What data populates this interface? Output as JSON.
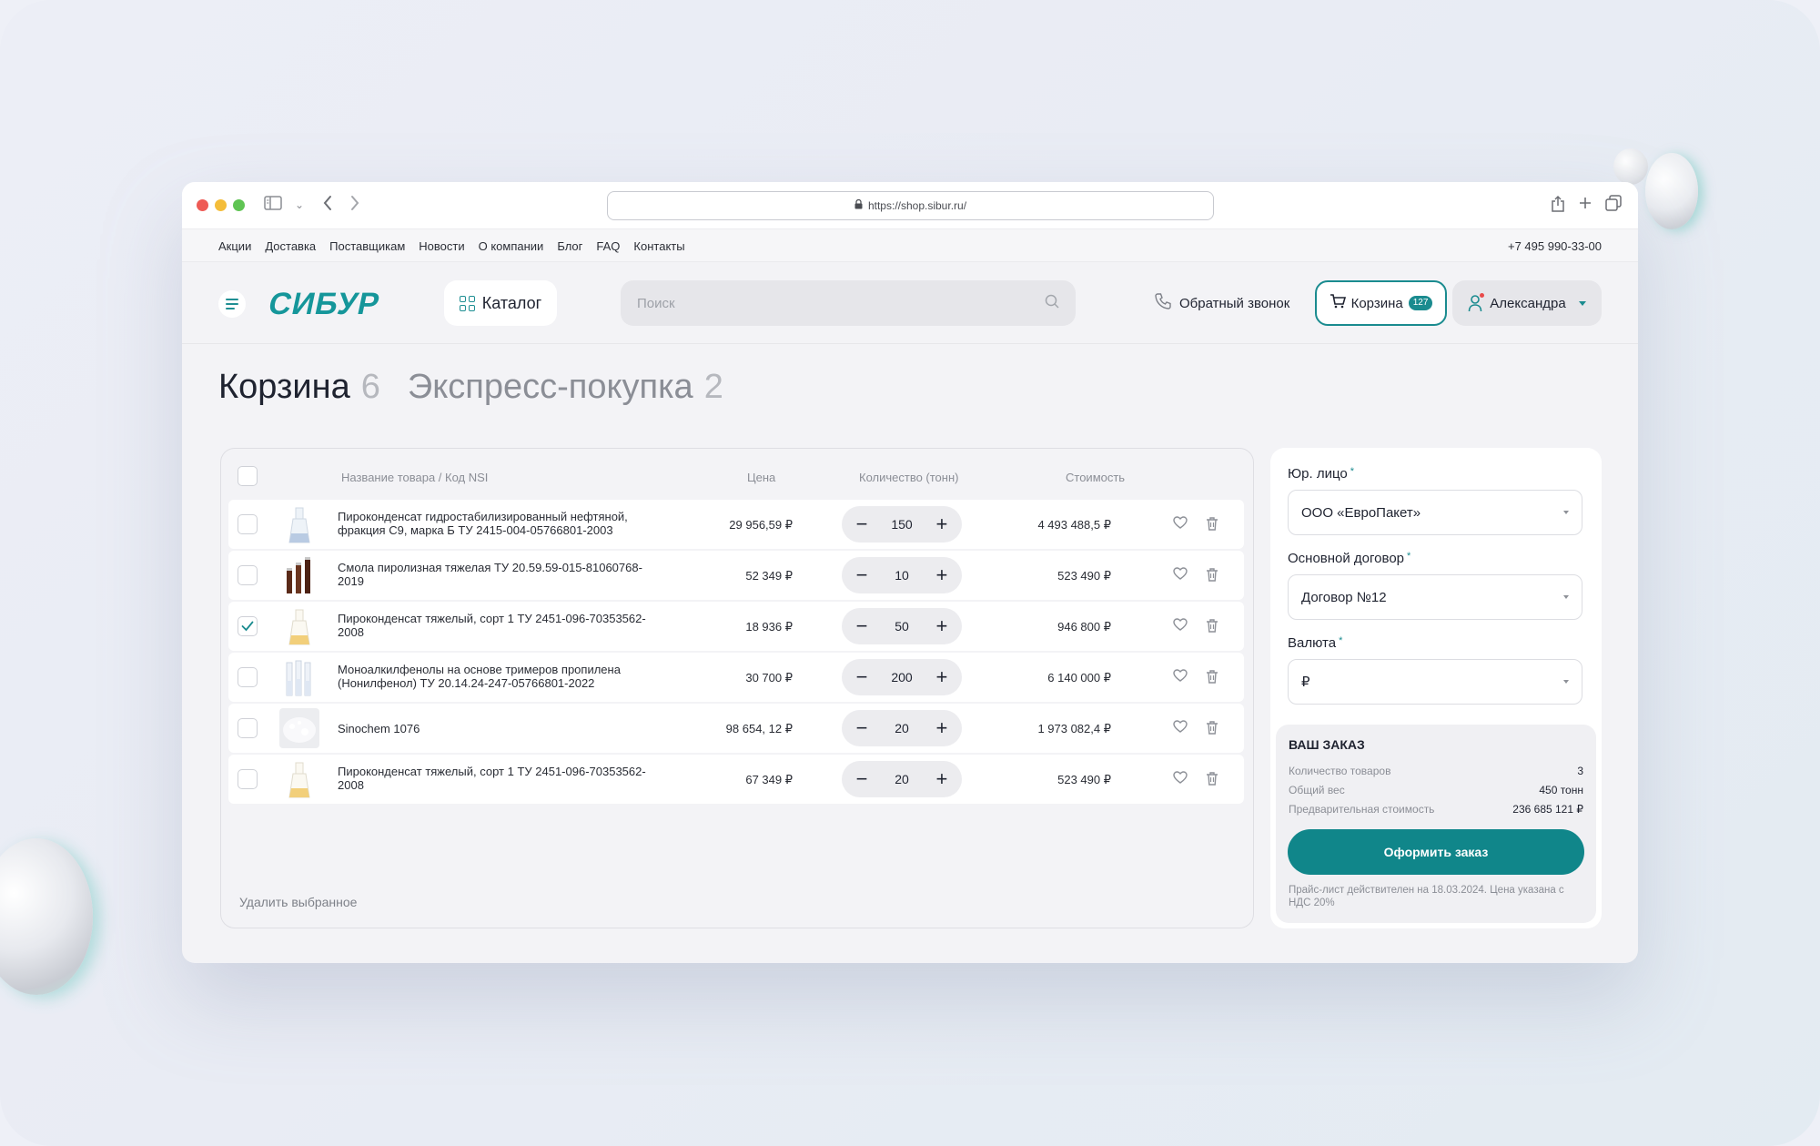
{
  "browser": {
    "url": "https://shop.sibur.ru/"
  },
  "topnav": {
    "links": [
      "Акции",
      "Доставка",
      "Поставщикам",
      "Новости",
      "О компании",
      "Блог",
      "FAQ",
      "Контакты"
    ],
    "phone": "+7 495 990-33-00"
  },
  "header": {
    "logo_text": "СИБУР",
    "catalog_label": "Каталог",
    "search_placeholder": "Поиск",
    "callback_label": "Обратный звонок",
    "cart_label": "Корзина",
    "cart_count": "127",
    "user_name": "Александра"
  },
  "tabs": [
    {
      "label": "Корзина",
      "count": "6"
    },
    {
      "label": "Экспресс-покупка",
      "count": "2"
    }
  ],
  "table": {
    "headers": {
      "name": "Название товара / Код NSI",
      "price": "Цена",
      "qty": "Количество (тонн)",
      "total": "Стоимость"
    },
    "rows": [
      {
        "name": "Пироконденсат гидростабилизированный нефтяной, фракция С9, марка Б ТУ 2415-004-05766801-2003",
        "price": "29 956,59 ₽",
        "qty": "150",
        "total": "4 493 488,5 ₽",
        "checked": false,
        "thumb": "flask-blue"
      },
      {
        "name": "Смола пиролизная тяжелая ТУ 20.59.59-015-81060768-2019",
        "price": "52 349 ₽",
        "qty": "10",
        "total": "523 490 ₽",
        "checked": false,
        "thumb": "tubes-brown"
      },
      {
        "name": "Пироконденсат тяжелый, сорт 1 ТУ 2451-096-70353562-2008",
        "price": "18 936 ₽",
        "qty": "50",
        "total": "946 800 ₽",
        "checked": true,
        "thumb": "flask-yellow"
      },
      {
        "name": "Моноалкилфенолы на основе тримеров пропилена (Нонилфенол) ТУ 20.14.24-247-05766801-2022",
        "price": "30 700 ₽",
        "qty": "200",
        "total": "6 140 000 ₽",
        "checked": false,
        "thumb": "tubes-clear"
      },
      {
        "name": "Sinochem 1076",
        "price": "98 654, 12 ₽",
        "qty": "20",
        "total": "1 973 082,4 ₽",
        "checked": false,
        "thumb": "powder-white"
      },
      {
        "name": "Пироконденсат тяжелый, сорт 1 ТУ 2451-096-70353562-2008",
        "price": "67 349 ₽",
        "qty": "20",
        "total": "523 490 ₽",
        "checked": false,
        "thumb": "flask-yellow"
      }
    ],
    "delete_selected": "Удалить выбранное"
  },
  "sidebar": {
    "legal_entity_label": "Юр. лицо",
    "legal_entity_value": "ООО «ЕвроПакет»",
    "contract_label": "Основной договор",
    "contract_value": "Договор №12",
    "currency_label": "Валюта",
    "currency_value": "₽",
    "required_mark": "*",
    "order": {
      "title": "ВАШ ЗАКАЗ",
      "items_label": "Количество товаров",
      "items_value": "3",
      "weight_label": "Общий вес",
      "weight_value": "450 тонн",
      "cost_label": "Предварительная стоимость",
      "cost_value": "236 685 121 ₽",
      "submit_label": "Оформить заказ",
      "note": "Прайс-лист действителен на 18.03.2024. Цена указана с НДС 20%"
    }
  },
  "colors": {
    "accent": "#10868a",
    "notification": "#e94a4a"
  }
}
